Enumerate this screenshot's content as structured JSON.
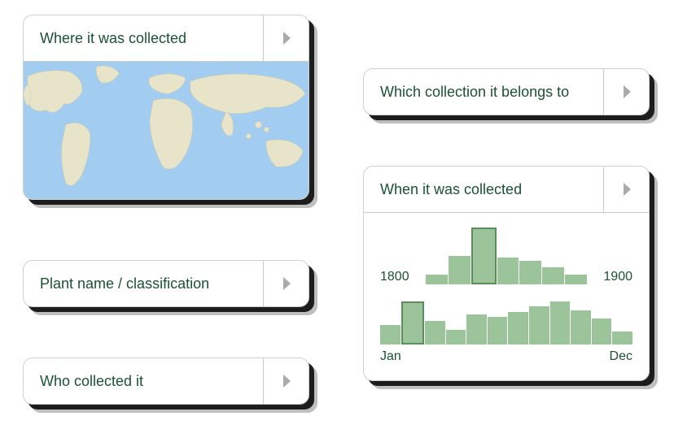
{
  "cards": {
    "where": {
      "title": "Where it was collected"
    },
    "plant": {
      "title": "Plant name / classification"
    },
    "who": {
      "title": "Who collected it"
    },
    "which": {
      "title": "Which collection it belongs to"
    },
    "when": {
      "title": "When it was collected"
    }
  },
  "when": {
    "year_axis": {
      "left": "1800",
      "right": "1900"
    },
    "month_axis": {
      "left": "Jan",
      "right": "Dec"
    }
  },
  "chart_data": [
    {
      "type": "bar",
      "name": "year-histogram",
      "xlabel_left": "1800",
      "xlabel_right": "1900",
      "categories": [
        "b1",
        "b2",
        "b3",
        "b4",
        "b5",
        "b6",
        "b7"
      ],
      "values": [
        10,
        30,
        60,
        28,
        25,
        18,
        10
      ],
      "selected_index": 2,
      "ylim": [
        0,
        60
      ]
    },
    {
      "type": "bar",
      "name": "month-histogram",
      "xlabel_left": "Jan",
      "xlabel_right": "Dec",
      "categories": [
        "Jan",
        "Feb",
        "Mar",
        "Apr",
        "May",
        "Jun",
        "Jul",
        "Aug",
        "Sep",
        "Oct",
        "Nov",
        "Dec"
      ],
      "values": [
        18,
        40,
        22,
        14,
        28,
        26,
        30,
        36,
        40,
        32,
        24,
        12
      ],
      "selected_index": 1,
      "ylim": [
        0,
        44
      ]
    }
  ],
  "colors": {
    "accent": "#1a5232",
    "bar": "#9bc49b",
    "bar_selected_border": "#5a8f5a",
    "ocean": "#a3cdf0",
    "land": "#e8e4c9"
  }
}
